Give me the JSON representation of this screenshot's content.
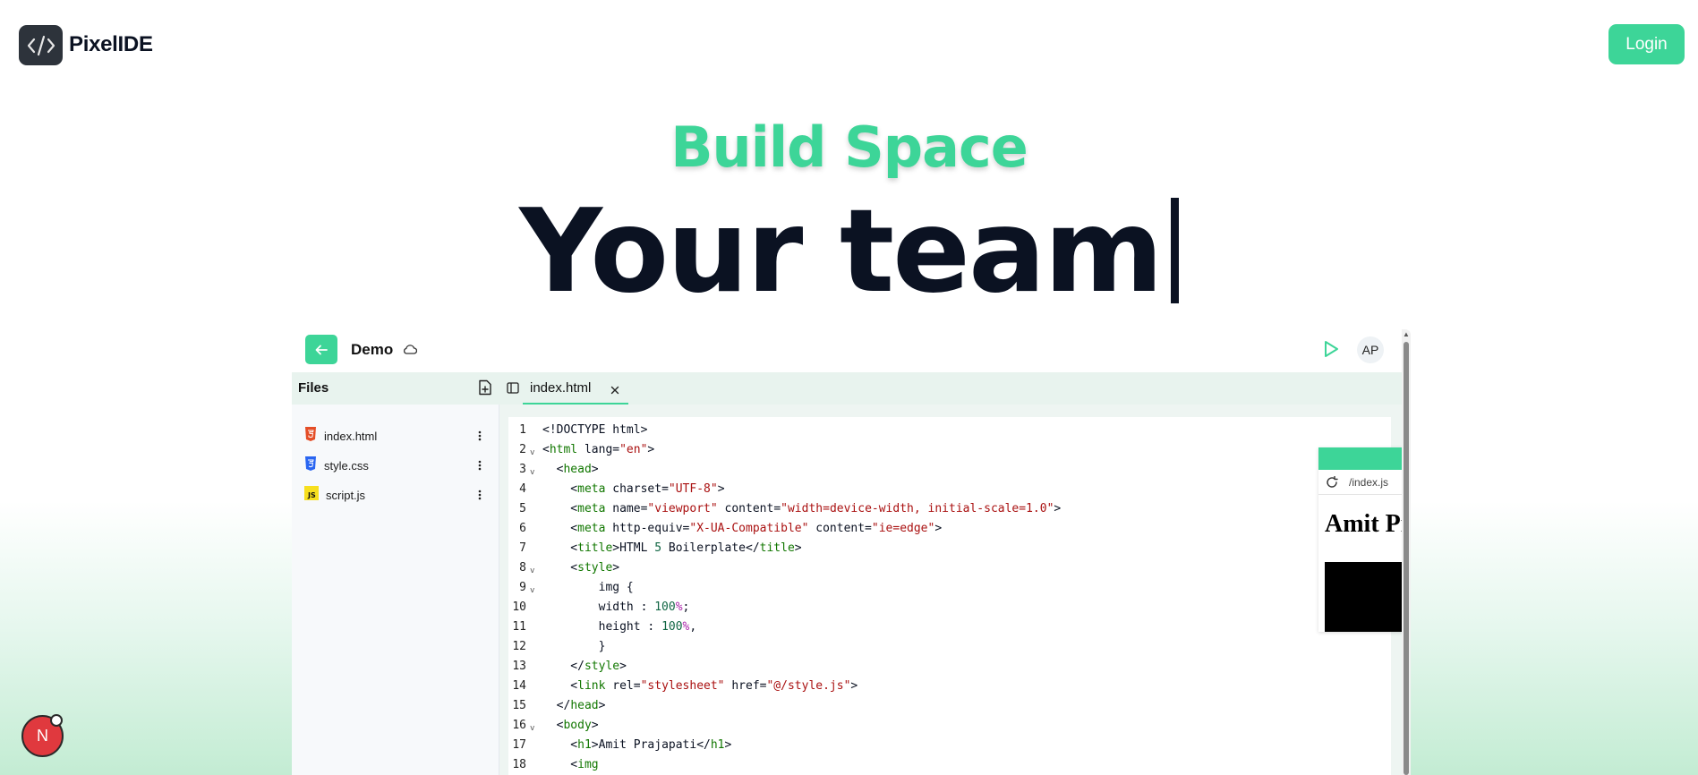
{
  "nav": {
    "brand": "PixelIDE",
    "login_label": "Login"
  },
  "hero": {
    "subtitle": "Build Space",
    "title": "Your team"
  },
  "ide": {
    "project_name": "Demo",
    "avatar_initials": "AP",
    "sidebar": {
      "title": "Files",
      "files": [
        {
          "name": "index.html",
          "icon": "html5-icon",
          "color": "#e44d26"
        },
        {
          "name": "style.css",
          "icon": "css3-icon",
          "color": "#2965f1"
        },
        {
          "name": "script.js",
          "icon": "js-icon",
          "color": "#f7df1e"
        }
      ]
    },
    "tab": {
      "label": "index.html"
    },
    "code_lines": [
      {
        "n": "1",
        "fold": "",
        "html": "<span class=\"pl\">&lt;!DOCTYPE html&gt;</span>",
        "text": "<!DOCTYPE html>"
      },
      {
        "n": "2",
        "fold": "v",
        "text": "<html lang=\"en\">"
      },
      {
        "n": "3",
        "fold": "v",
        "text": "  <head>"
      },
      {
        "n": "4",
        "fold": "",
        "text": "    <meta charset=\"UTF-8\">"
      },
      {
        "n": "5",
        "fold": "",
        "text": "    <meta name=\"viewport\" content=\"width=device-width, initial-scale=1.0\">"
      },
      {
        "n": "6",
        "fold": "",
        "text": "    <meta http-equiv=\"X-UA-Compatible\" content=\"ie=edge\">"
      },
      {
        "n": "7",
        "fold": "",
        "text": "    <title>HTML 5 Boilerplate</title>"
      },
      {
        "n": "8",
        "fold": "v",
        "text": "    <style>"
      },
      {
        "n": "9",
        "fold": "v",
        "text": "        img {"
      },
      {
        "n": "10",
        "fold": "",
        "text": "        width : 100%;"
      },
      {
        "n": "11",
        "fold": "",
        "text": "        height : 100%,"
      },
      {
        "n": "12",
        "fold": "",
        "text": "        }"
      },
      {
        "n": "13",
        "fold": "",
        "text": "    </style>"
      },
      {
        "n": "14",
        "fold": "",
        "text": "    <link rel=\"stylesheet\" href=\"@/style.js\">"
      },
      {
        "n": "15",
        "fold": "",
        "text": "  </head>"
      },
      {
        "n": "16",
        "fold": "v",
        "text": "  <body>"
      },
      {
        "n": "17",
        "fold": "",
        "text": "    <h1>Amit Prajapati</h1>"
      },
      {
        "n": "18",
        "fold": "",
        "text": "    <img"
      }
    ],
    "preview": {
      "url": "/index.js",
      "heading": "Amit Prajapati"
    }
  },
  "badge": {
    "letter": "N"
  },
  "colors": {
    "accent": "#3dd598",
    "dark": "#0b1222"
  }
}
